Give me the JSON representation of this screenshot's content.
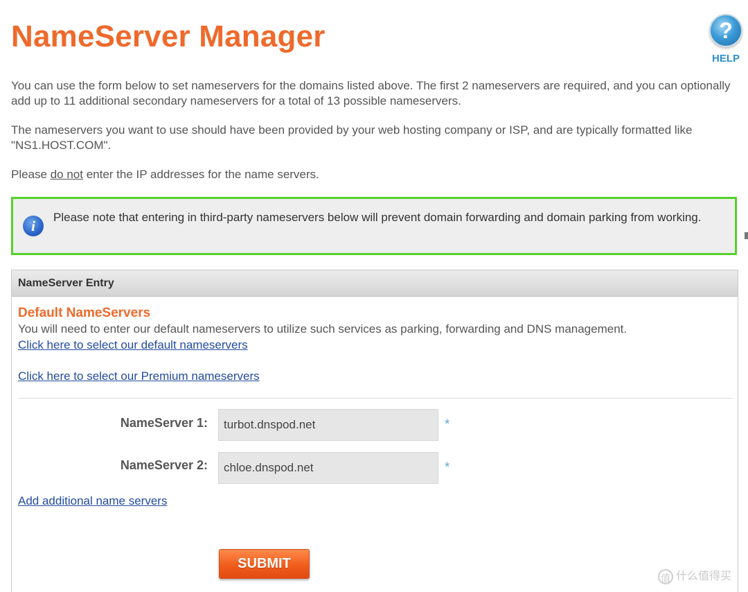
{
  "header": {
    "title": "NameServer Manager",
    "help_label": "HELP",
    "help_glyph": "?"
  },
  "intro": {
    "paragraph1": "You can use the form below to set nameservers for the domains listed above. The first 2 nameservers are required, and you can optionally add up to 11 additional secondary nameservers for a total of 13 possible nameservers.",
    "paragraph2": "The nameservers you want to use should have been provided by your web hosting company or ISP, and are typically formatted like \"NS1.HOST.COM\".",
    "paragraph3_prefix": "Please ",
    "paragraph3_emphasis": "do not",
    "paragraph3_suffix": " enter the IP addresses for the name servers."
  },
  "notice": {
    "icon": "info-icon",
    "icon_glyph": "i",
    "text": "Please note that entering in third-party nameservers below will prevent domain forwarding and domain parking from working.",
    "border_color": "#54d22a"
  },
  "entry": {
    "header": "NameServer Entry",
    "section_title": "Default NameServers",
    "section_desc": "You will need to enter our default nameservers to utilize such services as parking, forwarding and DNS management.",
    "link_default": "Click here to select our default nameservers",
    "link_premium": "Click here to select our Premium nameservers",
    "nameservers": [
      {
        "label": "NameServer 1:",
        "value": "turbot.dnspod.net",
        "required_mark": "*"
      },
      {
        "label": "NameServer 2:",
        "value": "chloe.dnspod.net",
        "required_mark": "*"
      }
    ],
    "link_add": "Add additional name servers",
    "submit_label": "SUBMIT"
  },
  "watermark": {
    "badge": "值",
    "text": "什么值得买"
  },
  "colors": {
    "accent": "#ee6a2c",
    "link": "#234b9e",
    "help": "#2d8fcf"
  }
}
